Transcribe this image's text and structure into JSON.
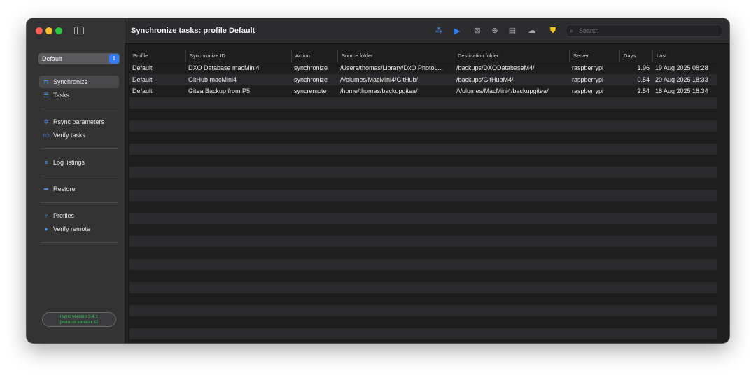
{
  "window": {
    "title": "Synchronize tasks: profile Default"
  },
  "sidebar": {
    "profile_value": "Default",
    "items": [
      {
        "label": "Synchronize",
        "icon": "sync-arrows-icon",
        "active": true
      },
      {
        "label": "Tasks",
        "icon": "list-icon"
      },
      {
        "label": "Rsync parameters",
        "icon": "gear-icon"
      },
      {
        "label": "Verify tasks",
        "icon": "thumbs-up-icon"
      },
      {
        "label": "Log listings",
        "icon": "log-lines-icon"
      },
      {
        "label": "Restore",
        "icon": "restore-arrow-icon"
      },
      {
        "label": "Profiles",
        "icon": "branch-icon"
      },
      {
        "label": "Verify remote",
        "icon": "check-circle-icon"
      }
    ],
    "rsync_version": "rsync  version 3.4.1",
    "protocol_version": "protocol version 32"
  },
  "toolbar": {
    "icons": [
      "wand-icon",
      "play-icon",
      "stop-box-icon",
      "zoom-icon",
      "document-icon",
      "cloud-sync-icon",
      "shield-bolt-icon"
    ],
    "search_placeholder": "Search"
  },
  "colors": {
    "accent": "#2f7cf6",
    "shield": "#f5c518",
    "rsync_text": "#35c759"
  },
  "table": {
    "columns": [
      "Profile",
      "Synchronize ID",
      "Action",
      "Source folder",
      "Destination folder",
      "Server",
      "Days",
      "Last"
    ],
    "rows": [
      [
        "Default",
        "DXO Database macMini4",
        "synchronize",
        "/Users/thomas/Library/DxO PhotoL...",
        "/backups/DXODatabaseM4/",
        "raspberrypi",
        "1.96",
        "19 Aug 2025 08:28"
      ],
      [
        "Default",
        "GitHub macMini4",
        "synchronize",
        "/Volumes/MacMini4/GitHub/",
        "/backups/GitHubM4/",
        "raspberrypi",
        "0.54",
        "20 Aug 2025 18:33"
      ],
      [
        "Default",
        "Gitea Backup from P5",
        "syncremote",
        "/home/thomas/backupgitea/",
        "/Volumes/MacMini4/backupgitea/",
        "raspberrypi",
        "2.54",
        "18 Aug 2025 18:34"
      ]
    ]
  }
}
